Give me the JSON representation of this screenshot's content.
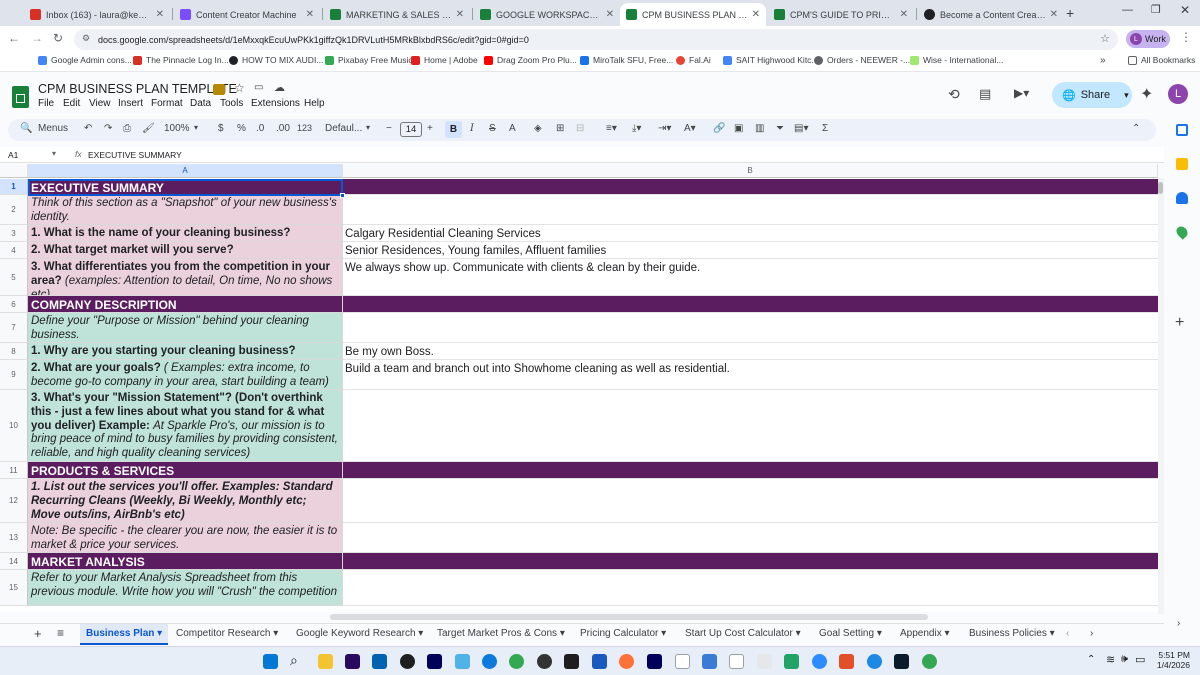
{
  "browser": {
    "tabs": [
      {
        "title": "Inbox (163) - laura@keenanvo...",
        "color": "#d93025",
        "active": false
      },
      {
        "title": "Content Creator Machine",
        "color": "#7c4dff",
        "active": false
      },
      {
        "title": "MARKETING & SALES STRATEG...",
        "color": "#188038",
        "active": false
      },
      {
        "title": "GOOGLE WORKSPACE & GMAIL...",
        "color": "#188038",
        "active": false
      },
      {
        "title": "CPM BUSINESS PLAN TEMPLAT...",
        "color": "#188038",
        "active": true
      },
      {
        "title": "CPM'S GUIDE TO PRICING & CL...",
        "color": "#188038",
        "active": false
      },
      {
        "title": "Become a Content Creator | W...",
        "color": "#202124",
        "active": false
      }
    ],
    "url": "docs.google.com/spreadsheets/d/1eMxxqkEcuUwPKk1giffzQk1DRVLutH5MRkBlxbdRS6c/edit?gid=0#gid=0",
    "profile_label": "Work",
    "bookmarks": [
      "Google Admin cons...",
      "The Pinnacle Log In...",
      "HOW TO MIX AUDI...",
      "Pixabay Free Music",
      "Home | Adobe",
      "Drag Zoom Pro Plu...",
      "MiroTalk SFU, Free...",
      "Fal.Ai",
      "SAIT Highwood Kitc...",
      "Orders - NEEWER -...",
      "Wise - International..."
    ],
    "all_bookmarks": "All Bookmarks"
  },
  "sheets": {
    "doc_title": "CPM BUSINESS PLAN TEMPLATE",
    "menus": [
      "File",
      "Edit",
      "View",
      "Insert",
      "Format",
      "Data",
      "Tools",
      "Extensions",
      "Help"
    ],
    "share_label": "Share",
    "avatar": "L",
    "toolbar": {
      "menus_label": "Menus",
      "zoom": "100%",
      "currency": "$",
      "percent": "%",
      "dec_less": ".0",
      "dec_more": ".00",
      "number_fmt": "123",
      "font": "Defaul...",
      "font_size": "14"
    },
    "name_box": "A1",
    "formula": "EXECUTIVE SUMMARY",
    "col_a": "A",
    "col_b": "B",
    "rows": [
      {
        "n": "1",
        "a": "EXECUTIVE SUMMARY",
        "b": "",
        "style": "sec"
      },
      {
        "n": "2",
        "a": "Think of this section as a \"Snapshot\" of your new business's identity.",
        "b": "",
        "style": "pink-ital"
      },
      {
        "n": "3",
        "a": "1. What is the name of your cleaning business?",
        "b": "Calgary Residential Cleaning Services",
        "style": "pink-bold"
      },
      {
        "n": "4",
        "a": "2. What target market will you serve?",
        "b": "Senior Residences, Young familes, Affluent families",
        "style": "pink-bold"
      },
      {
        "n": "5",
        "a_bold": "3. What differentiates you from the competition in your area?",
        "a_ital": " (examples: Attention to detail, On time, No no shows etc)",
        "b": "We always show up. Communicate with clients & clean by their guide.",
        "style": "pink-mixed"
      },
      {
        "n": "6",
        "a": "COMPANY DESCRIPTION",
        "b": "",
        "style": "sec"
      },
      {
        "n": "7",
        "a": "Define your \"Purpose or Mission\" behind your cleaning business.",
        "b": "",
        "style": "teal-ital"
      },
      {
        "n": "8",
        "a": "1. Why are you starting your cleaning business?",
        "b": "Be my own Boss.",
        "style": "teal-bold"
      },
      {
        "n": "9",
        "a_bold": "2. What are your goals?",
        "a_ital": " ( Examples: extra income, to become go-to company in your area, start building a team)",
        "b": "Build a team and branch out into Showhome cleaning as well as residential.",
        "style": "teal-mixed"
      },
      {
        "n": "10",
        "a_bold": "3. What's your \"Mission Statement\"? (Don't overthink this - just a few lines about what you stand for & what you deliver)  Example: ",
        "a_ital": " At Sparkle Pro's, our mission is to bring peace of mind to busy families by providing consistent, reliable, and high quality cleaning services)",
        "b": "",
        "style": "teal-mixed"
      },
      {
        "n": "11",
        "a": "PRODUCTS & SERVICES",
        "b": "",
        "style": "sec"
      },
      {
        "n": "12",
        "a": "1. List out the services you'll offer.  Examples: Standard Recurring Cleans (Weekly, Bi Weekly, Monthly etc; Move outs/ins, AirBnb's etc)",
        "b": "",
        "style": "pink-boldital"
      },
      {
        "n": "13",
        "a": "Note: Be specific - the clearer you are now, the easier it is to market & price your services.",
        "b": "",
        "style": "pink-ital"
      },
      {
        "n": "14",
        "a": "MARKET ANALYSIS",
        "b": "",
        "style": "sec"
      },
      {
        "n": "15",
        "a": "Refer to your Market Analysis Spreadsheet from this previous module.  Write how you will \"Crush\" the competition",
        "b": "",
        "style": "teal-ital"
      }
    ],
    "sheet_tabs": [
      "Business Plan",
      "Competitor Research",
      "Google Keyword Research",
      "Target Market Pros & Cons",
      "Pricing Calculator",
      "Start Up Cost Calculator",
      "Goal Setting",
      "Appendix",
      "Business Policies"
    ],
    "active_sheet": "Business Plan"
  },
  "taskbar": {
    "time": "5:51 PM",
    "date": "1/4/2026"
  },
  "colors": {
    "section": "#5b1d5f",
    "pink": "#ead1dc",
    "teal": "#bfe3d8",
    "accent": "#0b57d0"
  }
}
